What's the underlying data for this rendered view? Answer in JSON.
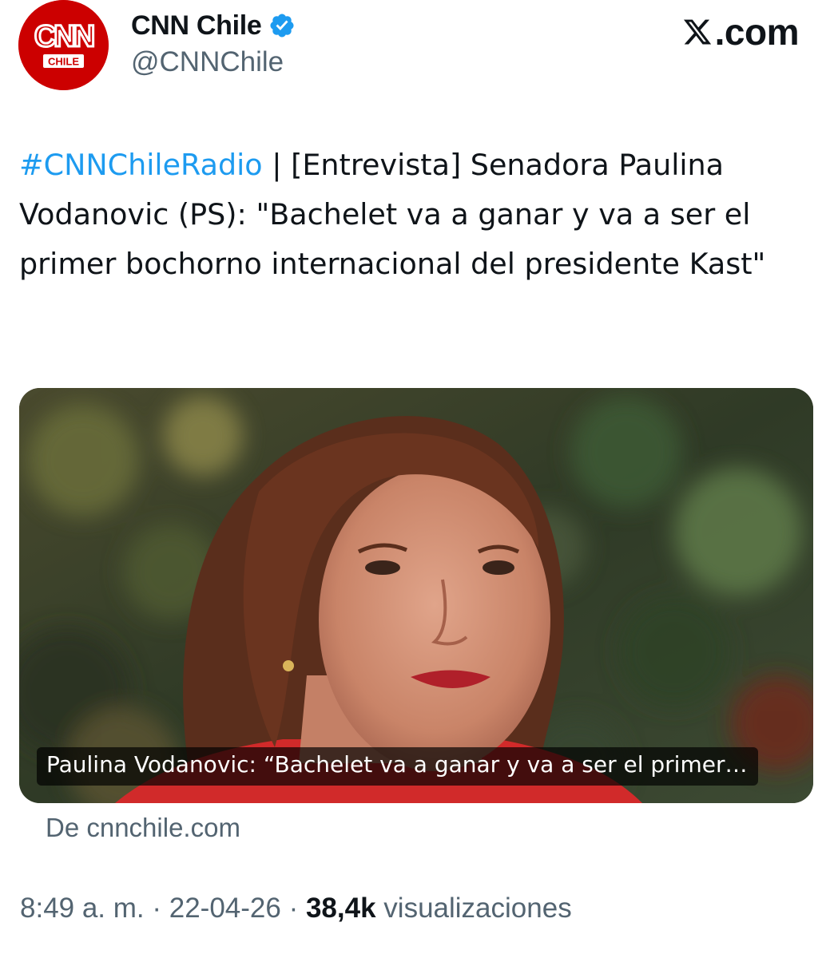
{
  "author": {
    "display_name": "CNN Chile",
    "handle": "@CNNChile",
    "avatar_logo_text": "CNN",
    "avatar_sub_text": "CHILE",
    "verified_icon": "verified-badge-icon"
  },
  "brand": {
    "site_label": ".com",
    "logo_icon": "x-logo-icon"
  },
  "tweet": {
    "hashtag": "#CNNChileRadio",
    "body": " | [Entrevista] Senadora Paulina Vodanovic (PS): \"Bachelet va a ganar y va a ser el primer bochorno internacional del presidente Kast\""
  },
  "card": {
    "caption": "Paulina Vodanovic: “Bachelet va a ganar y va a ser el primer…",
    "source": "De cnnchile.com"
  },
  "meta": {
    "time": "8:49 a. m.",
    "separator": " · ",
    "date": "22-04-26",
    "views_count": "38,4k",
    "views_label": "visualizaciones"
  },
  "colors": {
    "link": "#1d9bf0",
    "secondary_text": "#536471",
    "primary_text": "#0f1419",
    "cnn_red": "#cc0000",
    "verified_blue": "#1d9bf0"
  }
}
